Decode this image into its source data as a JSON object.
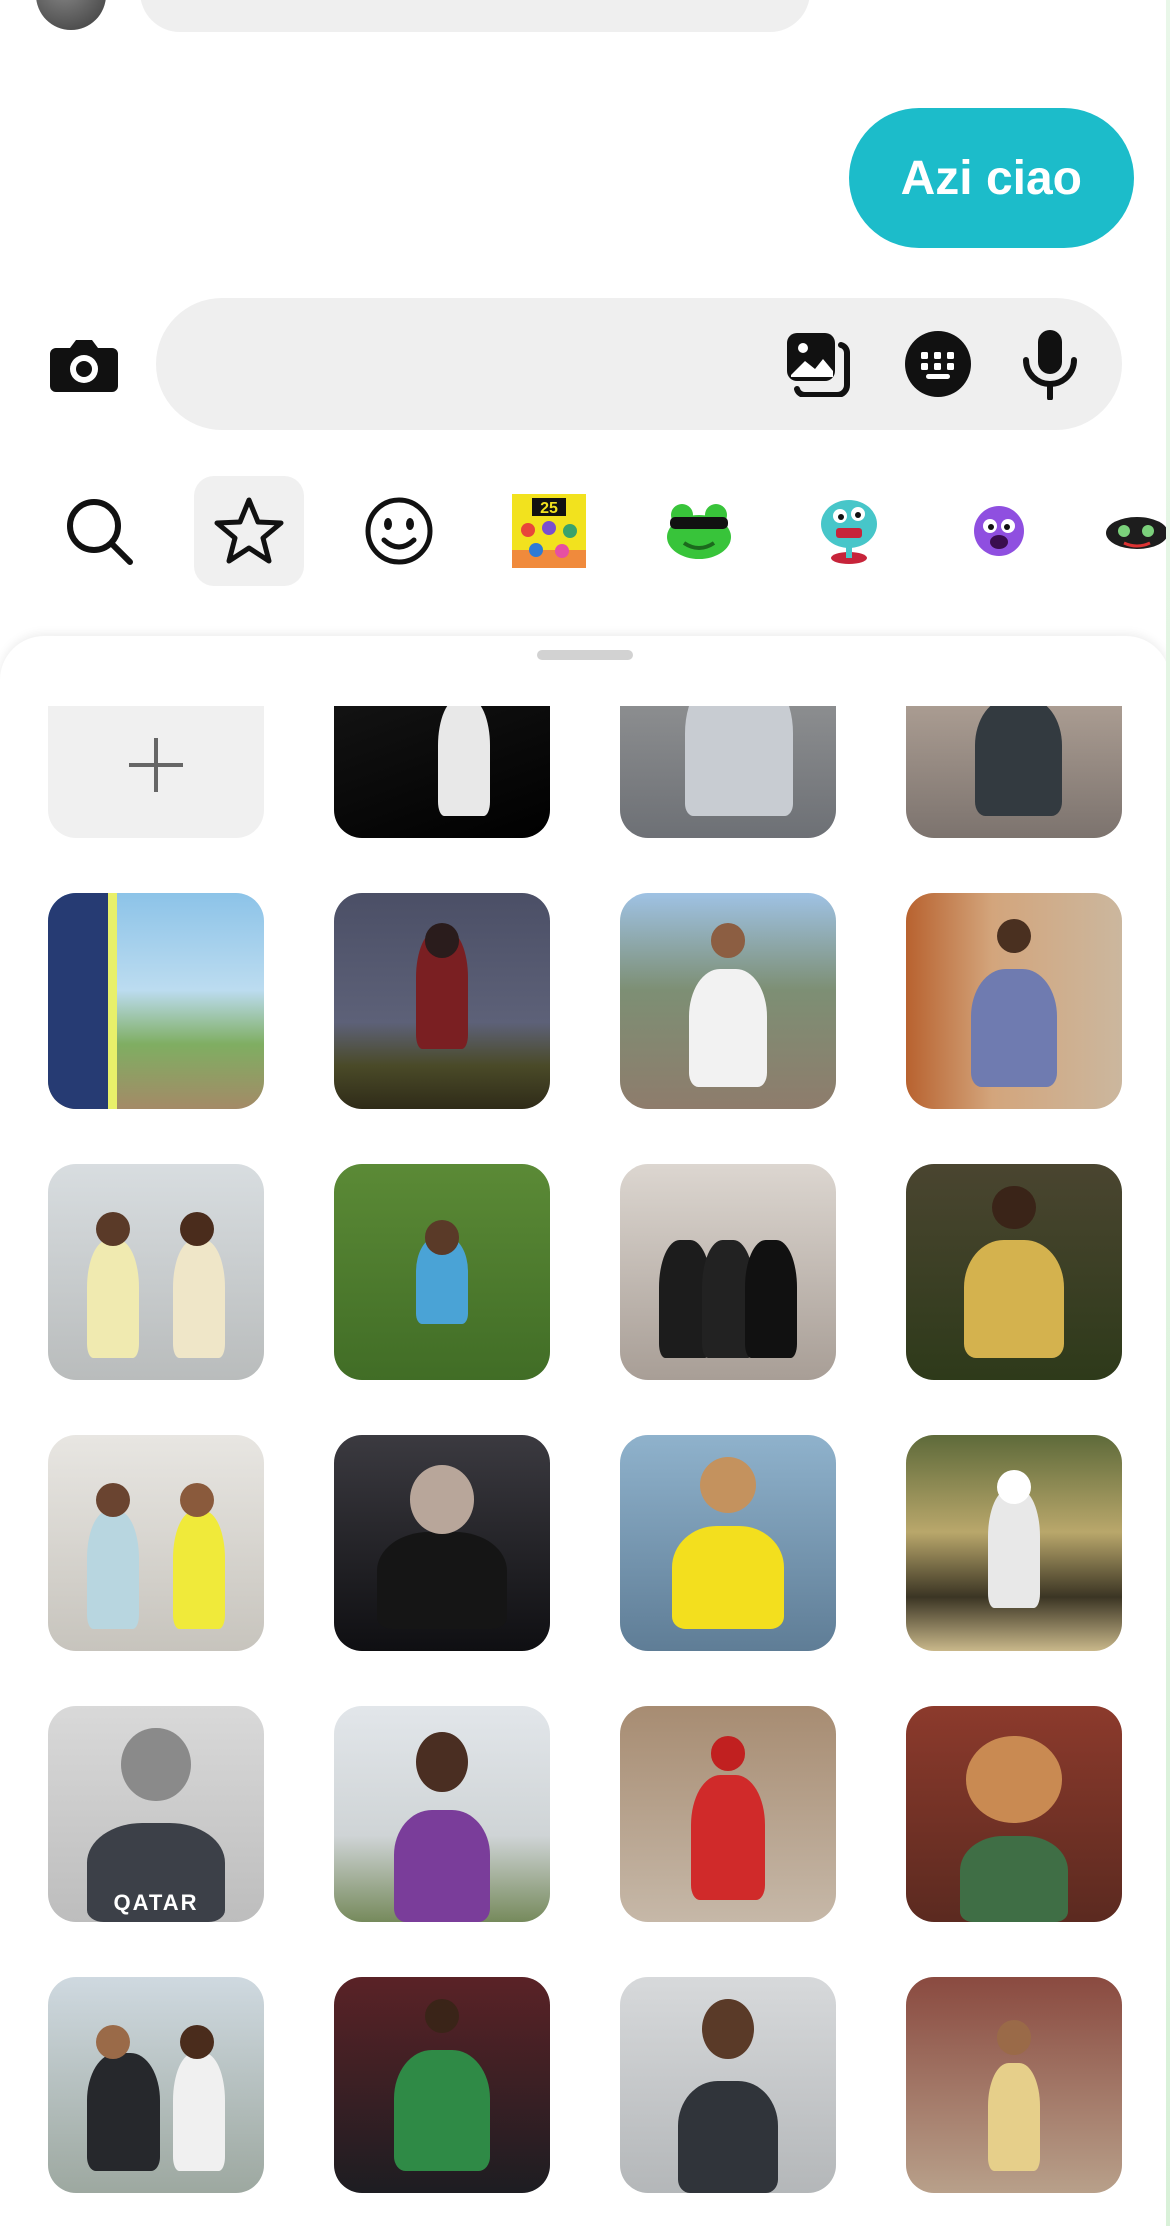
{
  "conversation": {
    "outgoing_message": "Azi ciao"
  },
  "composer": {
    "placeholder": "",
    "icons": [
      "camera-icon",
      "gallery-icon",
      "sticker-keyboard-icon",
      "microphone-icon"
    ]
  },
  "sticker_tabs": [
    {
      "name": "search-icon",
      "active": false
    },
    {
      "name": "star-icon",
      "active": true
    },
    {
      "name": "smiley-icon",
      "active": false
    },
    {
      "name": "sticker-pack-2025",
      "active": false
    },
    {
      "name": "sticker-pack-frog",
      "active": false
    },
    {
      "name": "sticker-pack-blue-creature",
      "active": false
    },
    {
      "name": "sticker-pack-purple-face",
      "active": false
    },
    {
      "name": "sticker-pack-dark-creature",
      "active": false
    }
  ],
  "sticker_pack_2025_label": "25",
  "sticker_grid": {
    "add_label": "+",
    "tile_captions": {
      "qatar_shirt": "QATAR"
    }
  },
  "colors": {
    "accent": "#1cbcca",
    "bubble_incoming": "#efefef",
    "sheet_background": "#ffffff"
  }
}
